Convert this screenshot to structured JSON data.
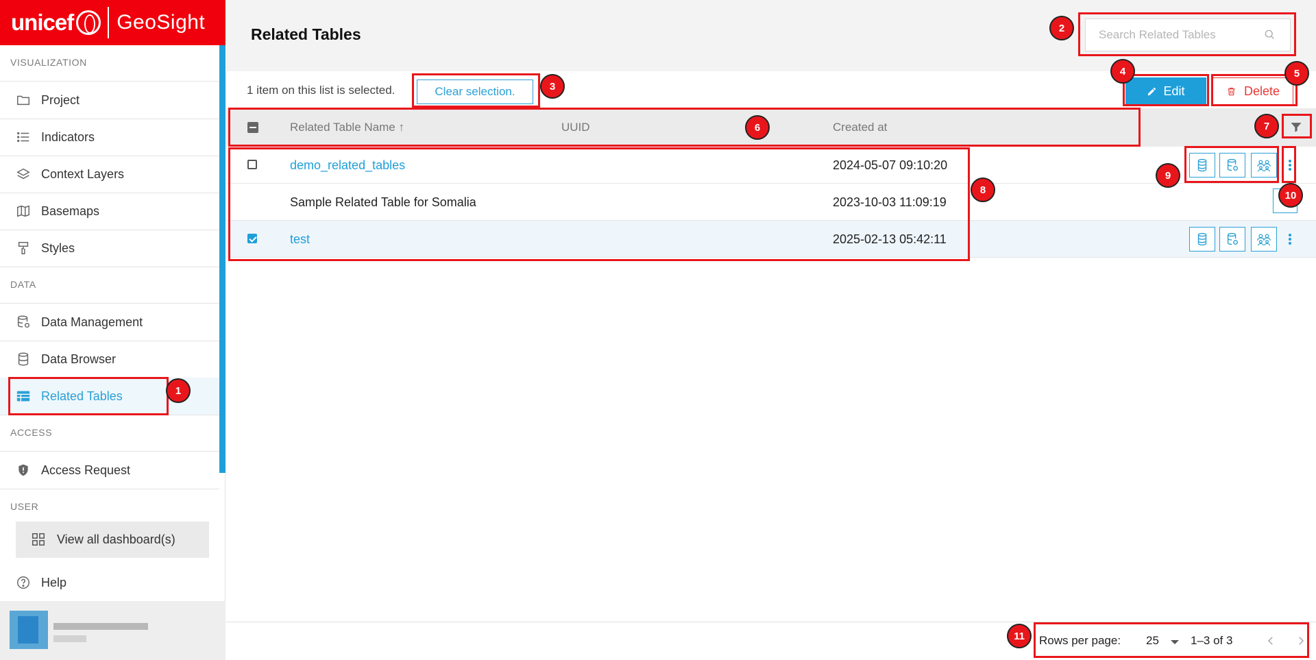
{
  "brand": {
    "name": "unicef",
    "product": "GeoSight"
  },
  "sidebar": {
    "sections": [
      "VISUALIZATION",
      "DATA",
      "ACCESS",
      "USER"
    ],
    "items": [
      {
        "label": "Project",
        "icon": "folder-icon"
      },
      {
        "label": "Indicators",
        "icon": "list-icon"
      },
      {
        "label": "Context Layers",
        "icon": "layers-icon"
      },
      {
        "label": "Basemaps",
        "icon": "map-icon"
      },
      {
        "label": "Styles",
        "icon": "paint-roller-icon"
      },
      {
        "label": "Data Management",
        "icon": "database-gear-icon"
      },
      {
        "label": "Data Browser",
        "icon": "database-icon"
      },
      {
        "label": "Related Tables",
        "icon": "table-icon",
        "active": true
      },
      {
        "label": "Access Request",
        "icon": "shield-icon"
      }
    ],
    "dashboards_label": "View all dashboard(s)",
    "help_label": "Help"
  },
  "header": {
    "title": "Related Tables",
    "search_placeholder": "Search Related Tables"
  },
  "selection": {
    "message": "1 item on this list is selected.",
    "clear_label": "Clear selection."
  },
  "toolbar": {
    "edit_label": "Edit",
    "delete_label": "Delete"
  },
  "table": {
    "columns": [
      "Related Table Name",
      "UUID",
      "Created at"
    ],
    "sort_indicator": "↑",
    "rows": [
      {
        "name": "demo_related_tables",
        "uuid": "",
        "created_at": "2024-05-07 09:10:20",
        "link": true,
        "checked": false
      },
      {
        "name": "Sample Related Table for Somalia",
        "uuid": "",
        "created_at": "2023-10-03 11:09:19",
        "link": false,
        "checked": null
      },
      {
        "name": "test",
        "uuid": "",
        "created_at": "2025-02-13 05:42:11",
        "link": true,
        "checked": true
      }
    ]
  },
  "pagination": {
    "rows_per_page_label": "Rows per page:",
    "rows_per_page": "25",
    "range": "1–3 of 3"
  },
  "annotations": [
    "1",
    "2",
    "3",
    "4",
    "5",
    "6",
    "7",
    "8",
    "9",
    "10",
    "11"
  ],
  "colors": {
    "brand_red": "#f0000c",
    "accent": "#1e9fda",
    "danger": "#e53935",
    "annotation": "#e8161b"
  }
}
